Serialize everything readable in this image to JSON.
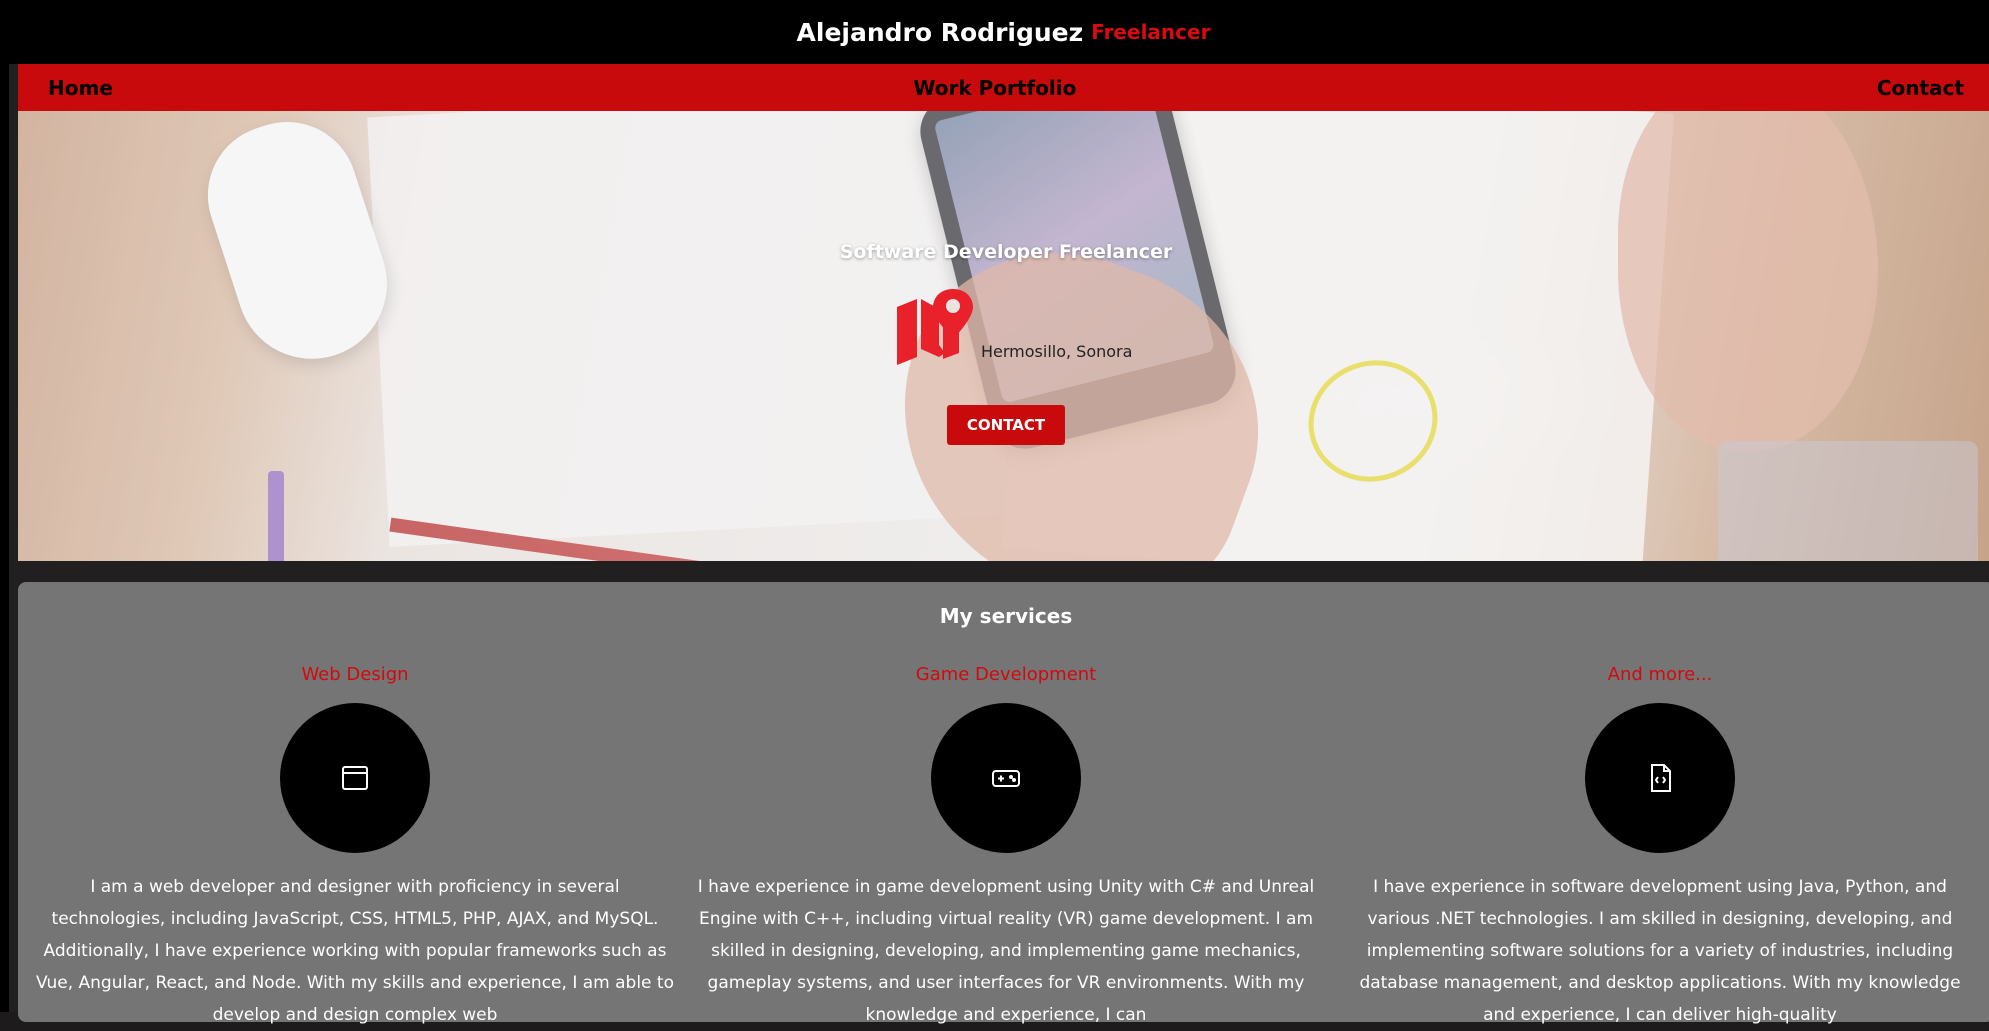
{
  "header": {
    "name": "Alejandro Rodriguez",
    "role": "Freelancer"
  },
  "nav": {
    "home": "Home",
    "portfolio": "Work Portfolio",
    "contact": "Contact"
  },
  "hero": {
    "title": "Software Developer Freelancer",
    "location_icon": "map-pin-icon",
    "location": "Hermosillo, Sonora",
    "button": "CONTACT"
  },
  "services": {
    "title": "My services",
    "items": [
      {
        "title": "Web Design",
        "icon": "browser-window-icon",
        "text": "I am a web developer and designer with proficiency in several technologies, including JavaScript, CSS, HTML5, PHP, AJAX, and MySQL. Additionally, I have experience working with popular frameworks such as Vue, Angular, React, and Node. With my skills and experience, I am able to develop and design complex web"
      },
      {
        "title": "Game Development",
        "icon": "gamepad-icon",
        "text": "I have experience in game development using Unity with C# and Unreal Engine with C++, including virtual reality (VR) game development. I am skilled in designing, developing, and implementing game mechanics, gameplay systems, and user interfaces for VR environments. With my knowledge and experience, I can"
      },
      {
        "title": "And more...",
        "icon": "code-file-icon",
        "text": "I have experience in software development using Java, Python, and various .NET technologies. I am skilled in designing, developing, and implementing software solutions for a variety of industries, including database management, and desktop applications. With my knowledge and experience, I can deliver high-quality"
      }
    ]
  },
  "colors": {
    "accent": "#c90a0c",
    "title_accent": "#d80c10",
    "services_bg": "#757575",
    "topbar_bg": "#000000"
  }
}
